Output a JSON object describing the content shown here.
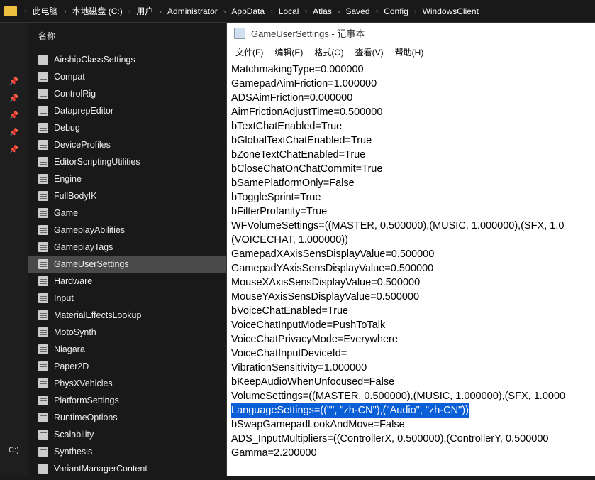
{
  "breadcrumb": [
    "此电脑",
    "本地磁盘 (C:)",
    "用户",
    "Administrator",
    "AppData",
    "Local",
    "Atlas",
    "Saved",
    "Config",
    "WindowsClient"
  ],
  "panel": {
    "header": "名称",
    "driveLabel": "C:)",
    "files": [
      "AirshipClassSettings",
      "Compat",
      "ControlRig",
      "DataprepEditor",
      "Debug",
      "DeviceProfiles",
      "EditorScriptingUtilities",
      "Engine",
      "FullBodyIK",
      "Game",
      "GameplayAbilities",
      "GameplayTags",
      "GameUserSettings",
      "Hardware",
      "Input",
      "MaterialEffectsLookup",
      "MotoSynth",
      "Niagara",
      "Paper2D",
      "PhysXVehicles",
      "PlatformSettings",
      "RuntimeOptions",
      "Scalability",
      "Synthesis",
      "VariantManagerContent"
    ],
    "selected": "GameUserSettings"
  },
  "notepad": {
    "title": "GameUserSettings - 记事本",
    "menu": [
      "文件(F)",
      "编辑(E)",
      "格式(O)",
      "查看(V)",
      "帮助(H)"
    ],
    "lines": [
      "MatchmakingType=0.000000",
      "GamepadAimFriction=1.000000",
      "ADSAimFriction=0.000000",
      "AimFrictionAdjustTime=0.500000",
      "bTextChatEnabled=True",
      "bGlobalTextChatEnabled=True",
      "bZoneTextChatEnabled=True",
      "bCloseChatOnChatCommit=True",
      "bSamePlatformOnly=False",
      "bToggleSprint=True",
      "bFilterProfanity=True",
      "WFVolumeSettings=((MASTER, 0.500000),(MUSIC, 1.000000),(SFX, 1.0",
      "(VOICECHAT, 1.000000))",
      "GamepadXAxisSensDisplayValue=0.500000",
      "GamepadYAxisSensDisplayValue=0.500000",
      "MouseXAxisSensDisplayValue=0.500000",
      "MouseYAxisSensDisplayValue=0.500000",
      "bVoiceChatEnabled=True",
      "VoiceChatInputMode=PushToTalk",
      "VoiceChatPrivacyMode=Everywhere",
      "VoiceChatInputDeviceId=",
      "VibrationSensitivity=1.000000",
      "bKeepAudioWhenUnfocused=False",
      "VolumeSettings=((MASTER, 0.500000),(MUSIC, 1.000000),(SFX, 1.0000",
      "LanguageSettings=((\"\", \"zh-CN\"),(\"Audio\", \"zh-CN\"))",
      "bSwapGamepadLookAndMove=False",
      "ADS_InputMultipliers=((ControllerX, 0.500000),(ControllerY, 0.500000",
      "Gamma=2.200000"
    ],
    "highlightIndex": 24
  }
}
